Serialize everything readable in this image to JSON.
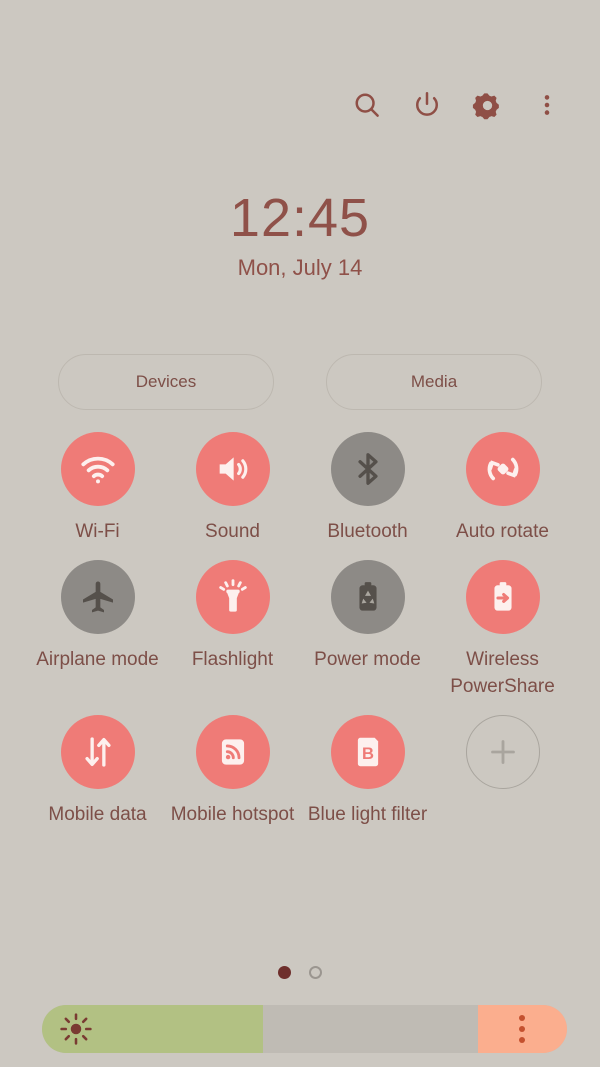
{
  "statusbar": {
    "icons": [
      {
        "name": "search-icon",
        "label": "Search"
      },
      {
        "name": "power-icon",
        "label": "Power"
      },
      {
        "name": "gear-icon",
        "label": "Settings"
      },
      {
        "name": "overflow-menu-icon",
        "label": "More options"
      }
    ]
  },
  "clock": {
    "time": "12:45",
    "date": "Mon, July 14"
  },
  "shortcuts": {
    "devices_label": "Devices",
    "media_label": "Media"
  },
  "tiles": [
    {
      "label": "Wi-Fi",
      "icon": "wifi-icon",
      "state": "on"
    },
    {
      "label": "Sound",
      "icon": "sound-icon",
      "state": "on"
    },
    {
      "label": "Bluetooth",
      "icon": "bluetooth-icon",
      "state": "off"
    },
    {
      "label": "Auto rotate",
      "icon": "auto-rotate-icon",
      "state": "on"
    },
    {
      "label": "Airplane mode",
      "icon": "airplane-icon",
      "state": "off"
    },
    {
      "label": "Flashlight",
      "icon": "flashlight-icon",
      "state": "on"
    },
    {
      "label": "Power mode",
      "icon": "power-mode-icon",
      "state": "off"
    },
    {
      "label": "Wireless PowerShare",
      "icon": "power-share-icon",
      "state": "on"
    },
    {
      "label": "Mobile data",
      "icon": "mobile-data-icon",
      "state": "on"
    },
    {
      "label": "Mobile hotspot",
      "icon": "mobile-hotspot-icon",
      "state": "on"
    },
    {
      "label": "Blue light filter",
      "icon": "blue-light-icon",
      "state": "on"
    },
    {
      "label": "",
      "icon": "plus-icon",
      "state": "add"
    }
  ],
  "pager": {
    "pages": 2,
    "active_index": 0
  },
  "brightness": {
    "icon": "brightness-sun-icon",
    "fill_percent": 42,
    "menu_icon": "overflow-menu-icon"
  },
  "colors": {
    "background": "#ccc8c1",
    "accent_on": "#ef7b77",
    "inactive": "#8d8a86",
    "text": "#7d4f48",
    "slider_fill": "#b2c183",
    "slider_track": "#bfbbb4",
    "slider_menu": "#fbae8e",
    "pager_active": "#6e2f2c"
  }
}
